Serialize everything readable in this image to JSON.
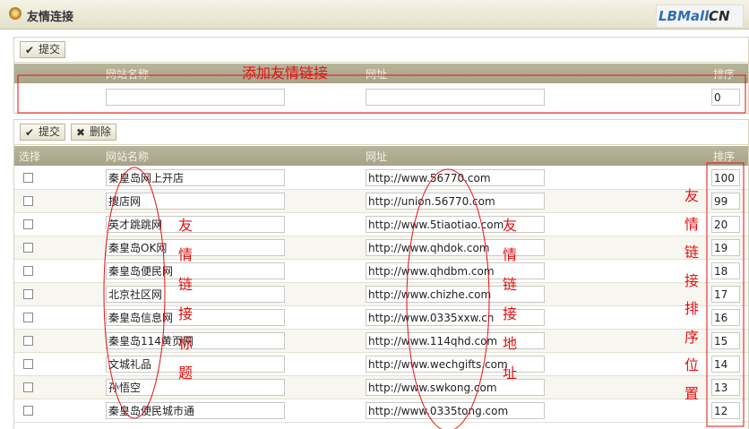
{
  "window": {
    "title": "友情连接"
  },
  "logo": {
    "part1": "LBMall.",
    "part2": "CN"
  },
  "add_panel": {
    "submit_label": "提交",
    "columns": {
      "name": "网站名称",
      "url": "网址",
      "order": "排序"
    },
    "new_link": {
      "name": "",
      "url": "",
      "order": "0"
    }
  },
  "list_panel": {
    "submit_label": "提交",
    "delete_label": "删除",
    "columns": {
      "select": "选择",
      "name": "网站名称",
      "url": "网址",
      "order": "排序"
    },
    "links": [
      {
        "name": "秦皇岛网上开店",
        "url": "http://www.56770.com",
        "order": "100"
      },
      {
        "name": "搜店网",
        "url": "http://union.56770.com",
        "order": "99"
      },
      {
        "name": "英才跳跳网",
        "url": "http://www.5tiaotiao.com",
        "order": "20"
      },
      {
        "name": "秦皇岛OK网",
        "url": "http://www.qhdok.com",
        "order": "19"
      },
      {
        "name": "秦皇岛便民网",
        "url": "http://www.qhdbm.com",
        "order": "18"
      },
      {
        "name": "北京社区网",
        "url": "http://www.chizhe.com",
        "order": "17"
      },
      {
        "name": "秦皇岛信息网",
        "url": "http://www.0335xxw.cn",
        "order": "16"
      },
      {
        "name": "秦皇岛114黄页网",
        "url": "http://www.114qhd.com",
        "order": "15"
      },
      {
        "name": "文城礼品",
        "url": "http://www.wechgifts.com",
        "order": "14"
      },
      {
        "name": "孙悟空",
        "url": "http://www.swkong.com",
        "order": "13"
      },
      {
        "name": "秦皇岛便民城市通",
        "url": "http://www.0335tong.com",
        "order": "12"
      }
    ]
  },
  "annotations": {
    "add_link": "添加友情链接",
    "title_col": [
      "友",
      "情",
      "链",
      "接",
      "标",
      "题"
    ],
    "url_col": [
      "友",
      "情",
      "链",
      "接",
      "地",
      "址"
    ],
    "order_col": [
      "友",
      "情",
      "链",
      "接",
      "排",
      "序",
      "位",
      "置"
    ]
  },
  "colors": {
    "annotation": "#e21212",
    "header_bg": "#b0ac92",
    "logo_blue": "#2e6fb6"
  }
}
